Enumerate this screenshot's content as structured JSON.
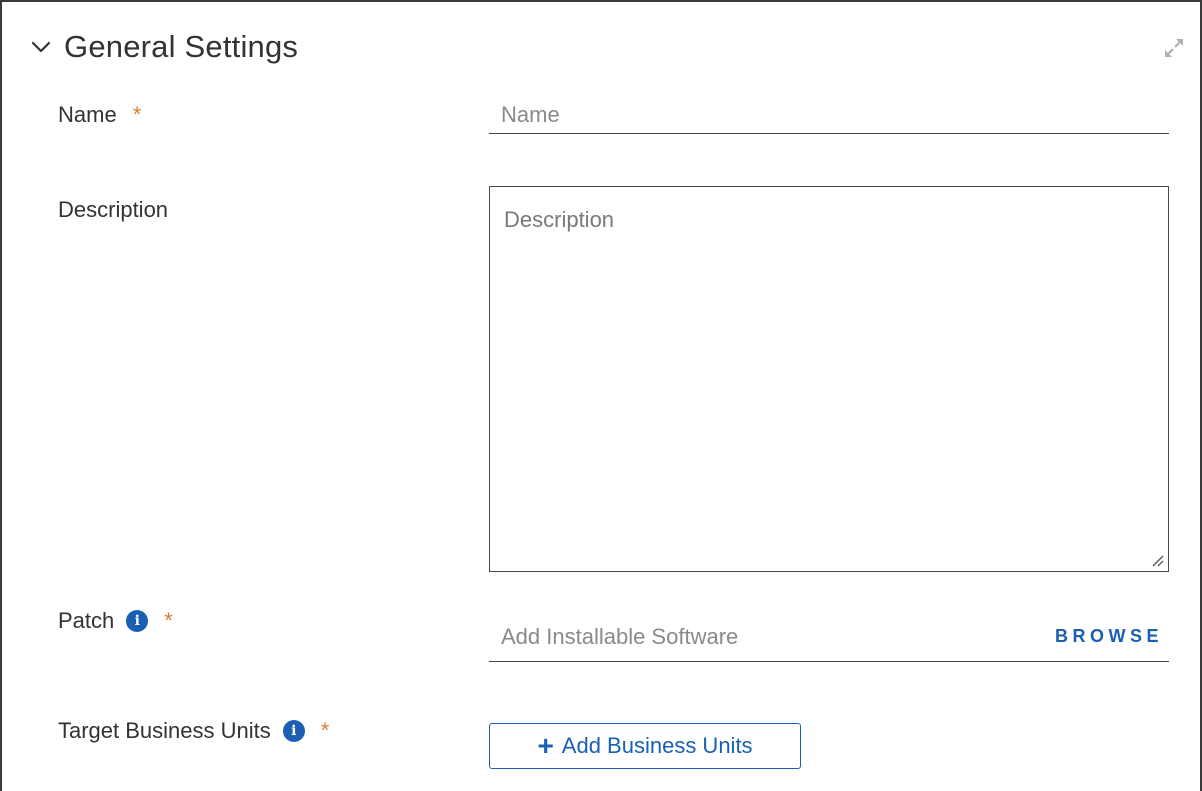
{
  "section": {
    "title": "General Settings",
    "chevron_icon": "chevron-down-icon",
    "expand_icon": "expand-icon"
  },
  "fields": {
    "name": {
      "label": "Name",
      "required_mark": "*",
      "placeholder": "Name",
      "value": ""
    },
    "description": {
      "label": "Description",
      "placeholder": "Description",
      "value": ""
    },
    "patch": {
      "label": "Patch",
      "required_mark": "*",
      "info_glyph": "i",
      "placeholder": "Add Installable Software",
      "browse_label": "BROWSE"
    },
    "target_business_units": {
      "label": "Target Business Units",
      "required_mark": "*",
      "info_glyph": "i",
      "add_label": "Add Business Units",
      "add_glyph": "+"
    }
  },
  "colors": {
    "accent": "#1a5fb4",
    "required": "#e07c2b",
    "text": "#333333",
    "placeholder": "#8a8a8a"
  }
}
